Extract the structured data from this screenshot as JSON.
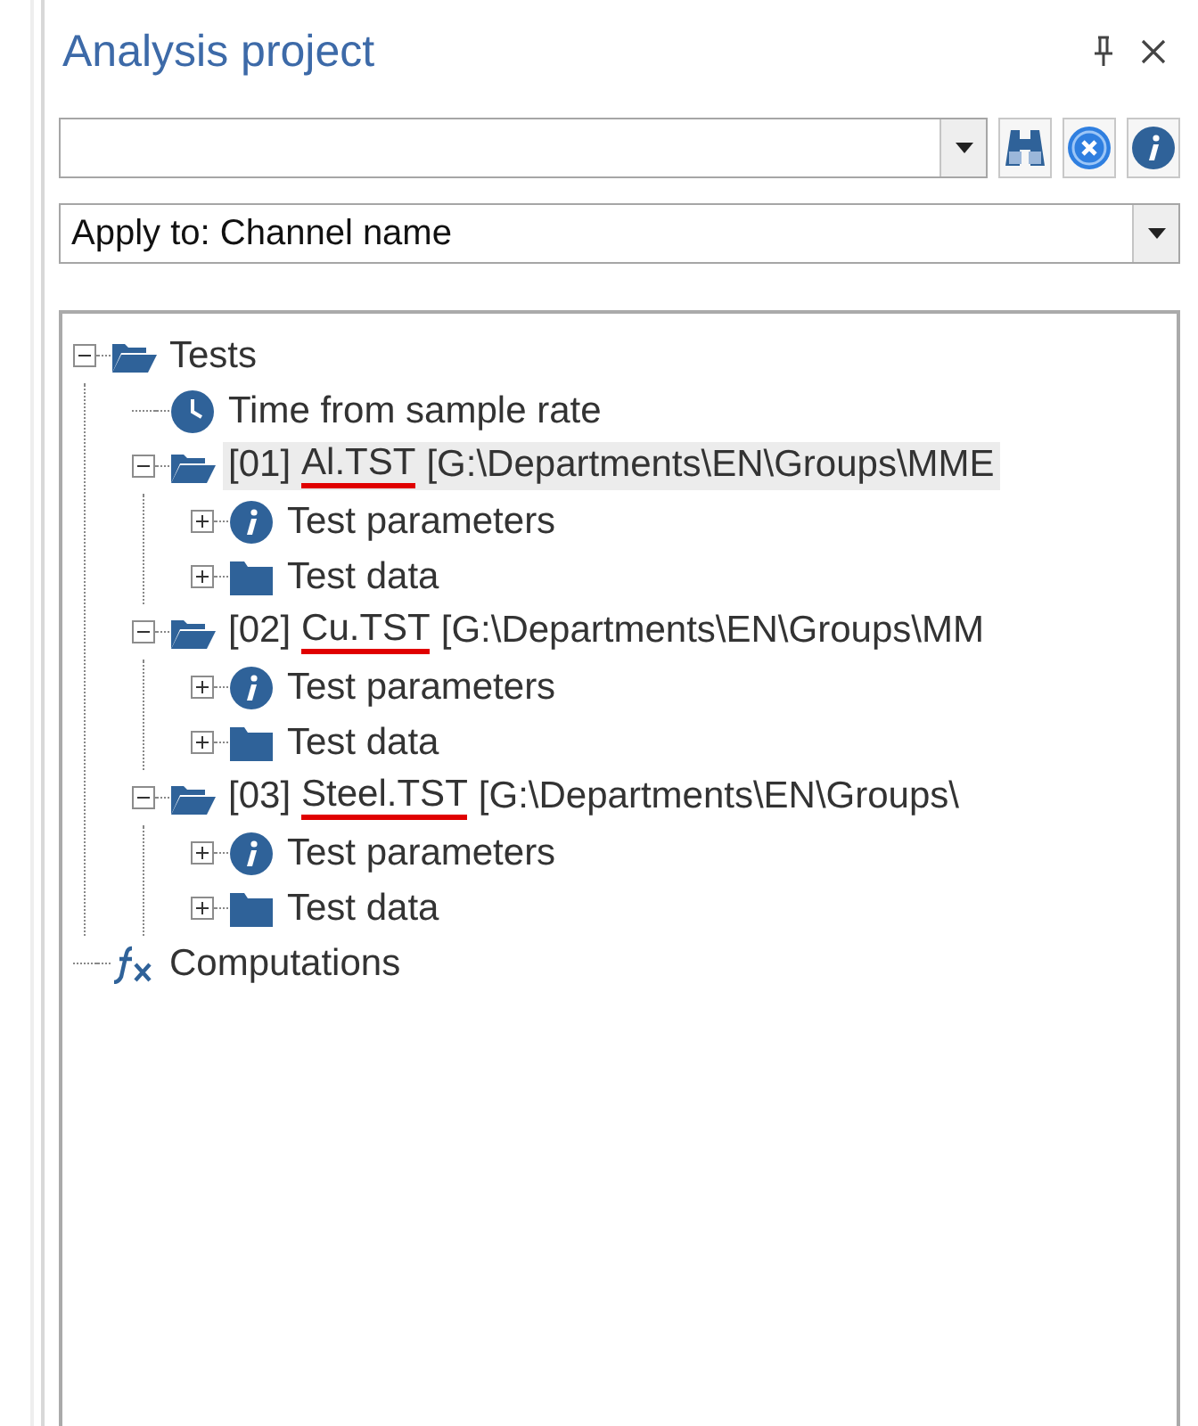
{
  "panel": {
    "title": "Analysis project"
  },
  "search": {
    "kind": "combo"
  },
  "apply_to": {
    "value": "Apply to: Channel name"
  },
  "tree": [
    {
      "kind": "folder-open",
      "label": "Tests",
      "expanded": true,
      "selected": false,
      "children": [
        {
          "kind": "clock",
          "label": "Time from sample rate",
          "selected": false
        },
        {
          "kind": "folder-open",
          "index": "[01]",
          "file": "Al.TST",
          "path": "[G:\\Departments\\EN\\Groups\\MME",
          "file_marked": true,
          "expanded": true,
          "selected": true,
          "children": [
            {
              "kind": "info",
              "label": "Test parameters",
              "expanded": false,
              "selected": false
            },
            {
              "kind": "folder",
              "label": "Test data",
              "expanded": false,
              "selected": false
            }
          ]
        },
        {
          "kind": "folder-open",
          "index": "[02]",
          "file": "Cu.TST",
          "path": "[G:\\Departments\\EN\\Groups\\MM",
          "file_marked": true,
          "expanded": true,
          "selected": false,
          "children": [
            {
              "kind": "info",
              "label": "Test parameters",
              "expanded": false,
              "selected": false
            },
            {
              "kind": "folder",
              "label": "Test data",
              "expanded": false,
              "selected": false
            }
          ]
        },
        {
          "kind": "folder-open",
          "index": "[03]",
          "file": "Steel.TST",
          "path": "[G:\\Departments\\EN\\Groups\\",
          "file_marked": true,
          "expanded": true,
          "selected": false,
          "children": [
            {
              "kind": "info",
              "label": "Test parameters",
              "expanded": false,
              "selected": false
            },
            {
              "kind": "folder",
              "label": "Test data",
              "expanded": false,
              "selected": false
            }
          ]
        }
      ]
    },
    {
      "kind": "function",
      "label": "Computations",
      "selected": false
    }
  ]
}
